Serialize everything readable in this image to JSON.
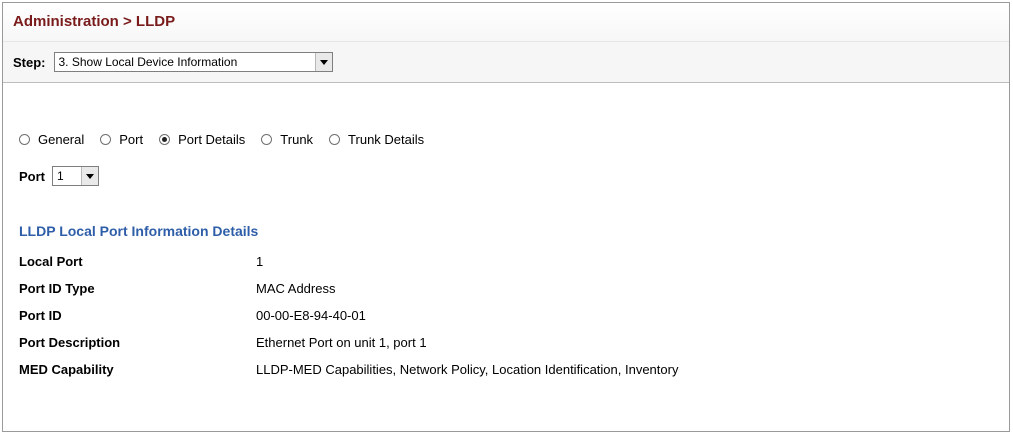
{
  "header": {
    "title": "Administration > LLDP"
  },
  "step": {
    "label": "Step:",
    "selected": "3. Show Local Device Information"
  },
  "view_options": [
    {
      "label": "General",
      "checked": false
    },
    {
      "label": "Port",
      "checked": false
    },
    {
      "label": "Port Details",
      "checked": true
    },
    {
      "label": "Trunk",
      "checked": false
    },
    {
      "label": "Trunk Details",
      "checked": false
    }
  ],
  "port": {
    "label": "Port",
    "selected": "1"
  },
  "section": {
    "title": "LLDP Local Port Information Details",
    "rows": [
      {
        "label": "Local Port",
        "value": "1"
      },
      {
        "label": "Port ID Type",
        "value": "MAC Address"
      },
      {
        "label": "Port ID",
        "value": "00-00-E8-94-40-01"
      },
      {
        "label": "Port Description",
        "value": "Ethernet Port on unit 1, port 1"
      },
      {
        "label": "MED Capability",
        "value": "LLDP-MED Capabilities, Network Policy, Location Identification, Inventory"
      }
    ]
  }
}
